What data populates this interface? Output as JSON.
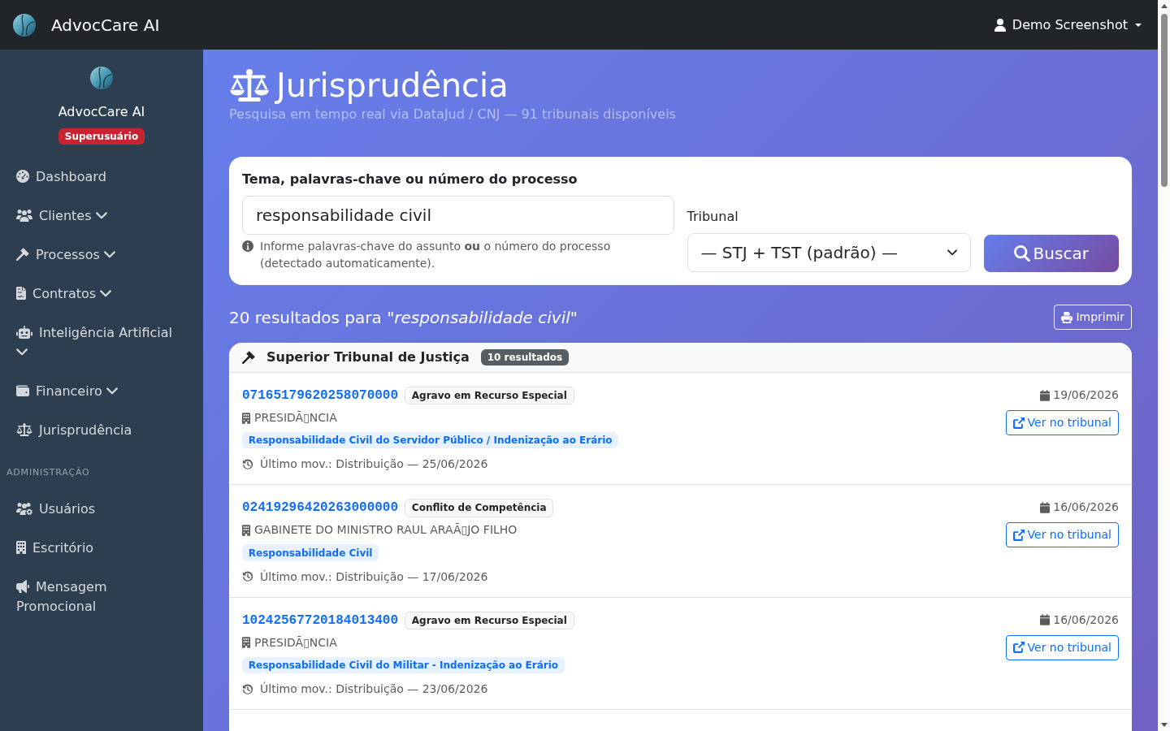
{
  "navbar": {
    "brand": "AdvocCare AI",
    "user": "Demo Screenshot"
  },
  "sidebar": {
    "brand": "AdvocCare AI",
    "role_badge": "Superusuário",
    "menu": [
      {
        "label": "Dashboard",
        "expandable": false
      },
      {
        "label": "Clientes",
        "expandable": true
      },
      {
        "label": "Processos",
        "expandable": true
      },
      {
        "label": "Contratos",
        "expandable": true
      },
      {
        "label": "Inteligência Artificial",
        "expandable": true
      },
      {
        "label": "Financeiro",
        "expandable": true
      },
      {
        "label": "Jurisprudência",
        "expandable": false
      }
    ],
    "admin_section": {
      "title": "ADMINISTRAÇÃO",
      "items": [
        {
          "label": "Usuários",
          "expandable": false
        },
        {
          "label": "Escritório",
          "expandable": false
        },
        {
          "label": "Mensagem Promocional",
          "expandable": false
        }
      ]
    }
  },
  "header": {
    "title": "Jurisprudência",
    "subtitle": "Pesquisa em tempo real via DataJud / CNJ — 91 tribunais disponíveis"
  },
  "search": {
    "query_label": "Tema, palavras-chave ou número do processo",
    "query_value": "responsabilidade civil",
    "help": "Informe palavras-chave do assunto **ou** o número do processo (detectado automaticamente).",
    "tribunal_label": "Tribunal",
    "tribunal_value": "— STJ + TST (padrão) —",
    "submit_button": "Buscar"
  },
  "results": {
    "summary": "20 resultados para \"*responsabilidade civil*\"",
    "print_button": "Imprimir",
    "groups": [
      {
        "court": "Superior Tribunal de Justiça",
        "count": "10 resultados",
        "items": [
          {
            "number": "07165179620258070000",
            "class": "Agravo em Recurso Especial",
            "organ": "PRESIDÃ▯NCIA",
            "subject": "Responsabilidade Civil do Servidor Público / Indenização ao Erário",
            "last_movement": "Último mov.: Distribuição — 25/06/2026",
            "date": "19/06/2026",
            "link": "Ver no tribunal"
          },
          {
            "number": "02419296420263000000",
            "class": "Conflito de Competência",
            "organ": "GABINETE DO MINISTRO RAUL ARAÃ▯JO FILHO",
            "subject": "Responsabilidade Civil",
            "last_movement": "Último mov.: Distribuição — 17/06/2026",
            "date": "16/06/2026",
            "link": "Ver no tribunal"
          },
          {
            "number": "10242567720184013400",
            "class": "Agravo em Recurso Especial",
            "organ": "PRESIDÃ▯NCIA",
            "subject": "Responsabilidade Civil do Militar - Indenização ao Erário",
            "last_movement": "Último mov.: Distribuição — 23/06/2026",
            "date": "16/06/2026",
            "link": "Ver no tribunal"
          }
        ]
      }
    ]
  }
}
